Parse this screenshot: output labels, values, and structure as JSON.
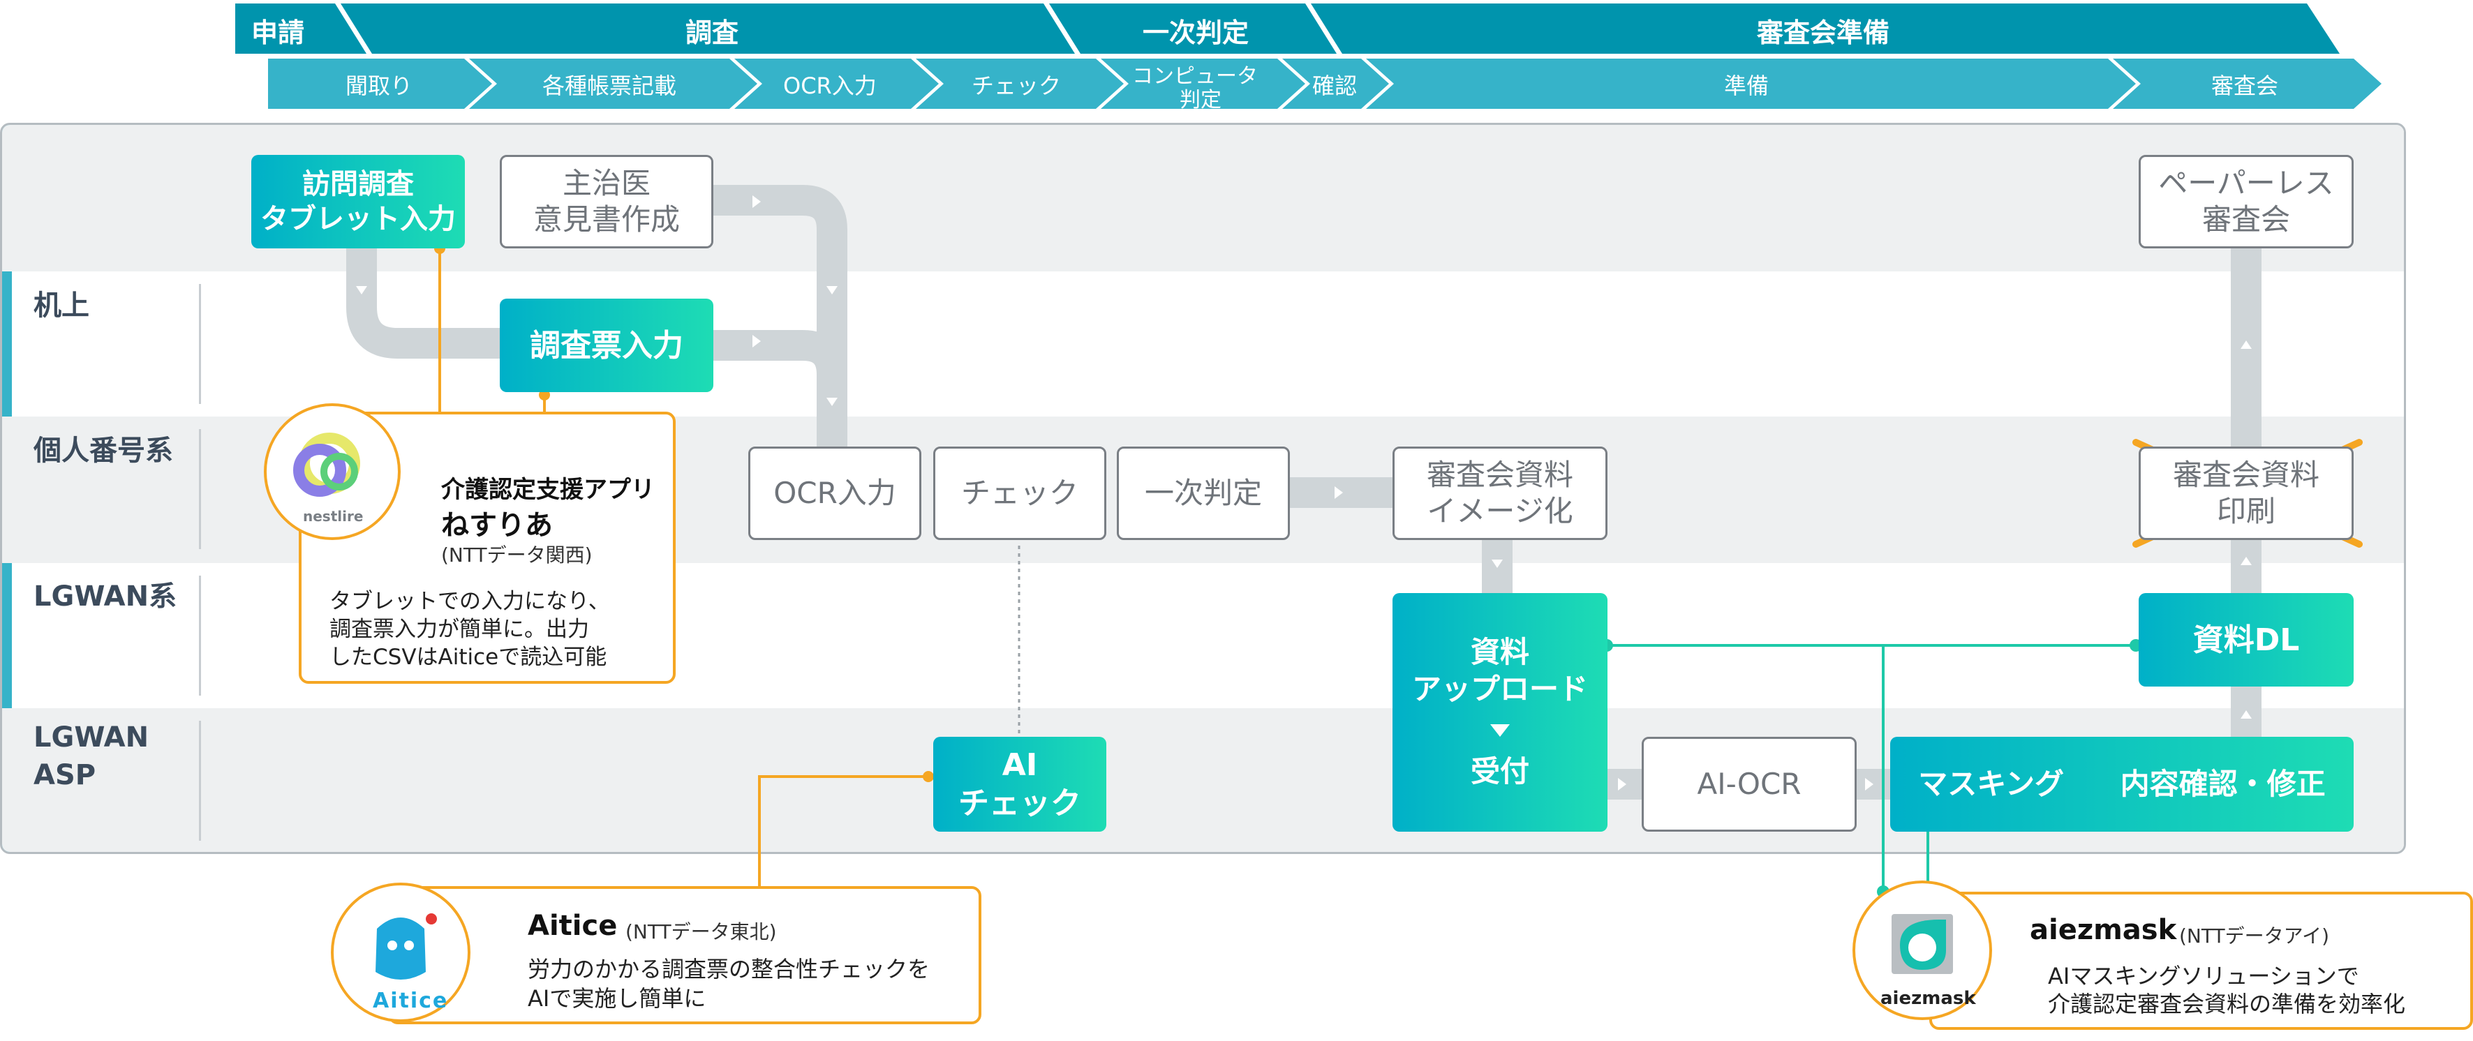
{
  "colors": {
    "header_dark": "#0094ad",
    "header_light": "#36b3c9",
    "accent_orange": "#f5a623",
    "lane_gray": "#eef0f1",
    "flow_gray": "#ccd2d5",
    "green_line": "#1ec9a8"
  },
  "header": {
    "phases": [
      "申請",
      "調査",
      "一次判定",
      "審査会準備"
    ],
    "steps": [
      "聞取り",
      "各種帳票記載",
      "OCR入力",
      "チェック",
      "コンピュータ",
      "判定",
      "確認",
      "準備",
      "審査会"
    ]
  },
  "lanes": [
    "机上",
    "個人番号系",
    "LGWAN系",
    "LGWAN",
    "ASP"
  ],
  "boxes": {
    "houmon": [
      "訪問調査",
      "タブレット入力"
    ],
    "shujii": [
      "主治医",
      "意見書作成"
    ],
    "chousahyou": "調査票入力",
    "paperless": [
      "ペーパーレス",
      "審査会"
    ],
    "ocr": "OCR入力",
    "check": "チェック",
    "ichiji": "一次判定",
    "image": [
      "審査会資料",
      "イメージ化"
    ],
    "print": [
      "審査会資料",
      "印刷"
    ],
    "upload": [
      "資料",
      "アップロード"
    ],
    "uketsuke": "受付",
    "dl": "資料DL",
    "ai_check": [
      "AI",
      "チェック"
    ],
    "ai_ocr": "AI-OCR",
    "masking": "マスキング",
    "naiyou": "内容確認・修正"
  },
  "callouts": {
    "nesuria": {
      "logo_text": "nestlire",
      "title": "介護認定支援アプリ",
      "name": "ねすりあ",
      "company": "(NTTデータ関西)",
      "desc": [
        "タブレットでの入力になり、",
        "調査票入力が簡単に。出力",
        "したCSVはAiticeで読込可能"
      ]
    },
    "aitice": {
      "logo_text": "Aitice",
      "name": "Aitice",
      "company": "(NTTデータ東北)",
      "desc": [
        "労力のかかる調査票の整合性チェックを",
        "AIで実施し簡単に"
      ]
    },
    "aiezmask": {
      "logo_text": "aiezmask",
      "name": "aiezmask",
      "company": "(NTTデータアイ)",
      "desc": [
        "AIマスキングソリューションで",
        "介護認定審査会資料の準備を効率化"
      ]
    }
  }
}
